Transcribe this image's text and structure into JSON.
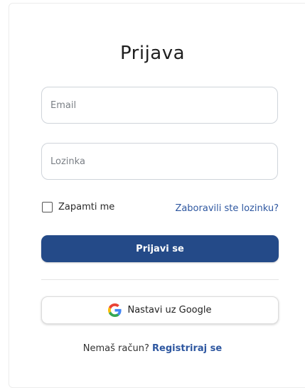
{
  "login": {
    "title": "Prijava",
    "email_placeholder": "Email",
    "password_placeholder": "Lozinka",
    "remember_label": "Zapamti me",
    "forgot_link": "Zaboravili ste lozinku?",
    "submit_label": "Prijavi se",
    "google_label": "Nastavi uz Google",
    "no_account_text": "Nemaš račun?",
    "register_link": "Registriraj se"
  },
  "colors": {
    "primary": "#244a88",
    "link": "#2e57a0"
  },
  "icons": {
    "google": "google-g-icon"
  }
}
